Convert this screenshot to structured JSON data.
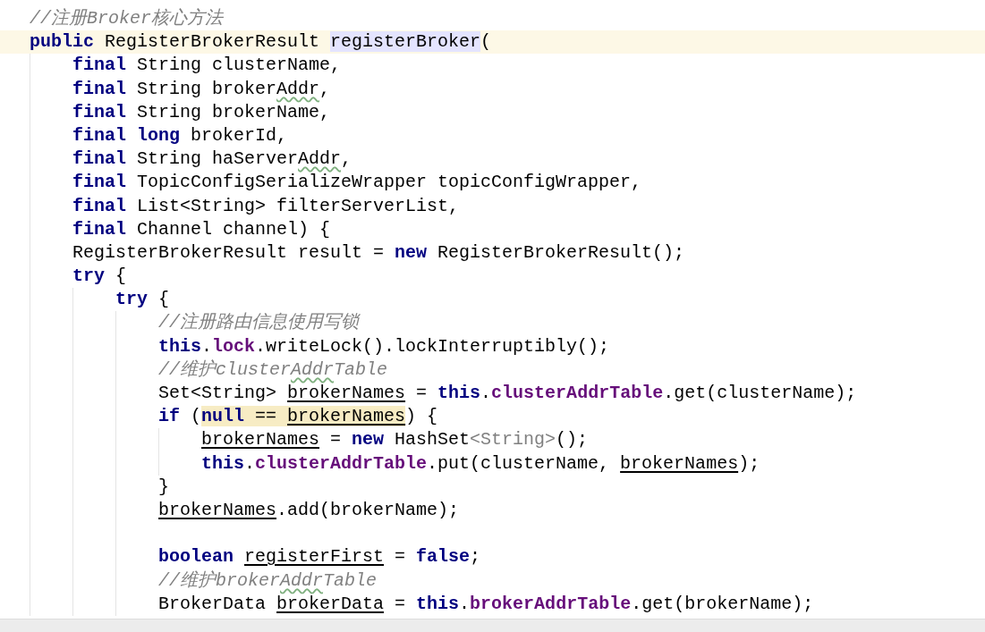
{
  "editor": {
    "lines": [
      {
        "kind": "code",
        "tokens": [
          {
            "text": "//注册Broker核心方法",
            "kind": "comment"
          }
        ]
      },
      {
        "kind": "code",
        "current": true,
        "tokens": [
          {
            "text": "public",
            "kind": "keyword"
          },
          {
            "text": " RegisterBrokerResult ",
            "kind": "plain"
          },
          {
            "text": "registerBroker",
            "kind": "plain",
            "usage": true
          },
          {
            "text": "(",
            "kind": "plain"
          }
        ],
        "children": [
          {
            "kind": "code",
            "tokens": [
              {
                "text": "final",
                "kind": "keyword"
              },
              {
                "text": " String clusterName,",
                "kind": "plain"
              }
            ]
          },
          {
            "kind": "code",
            "tokens": [
              {
                "text": "final",
                "kind": "keyword"
              },
              {
                "text": " String broker",
                "kind": "plain"
              },
              {
                "text": "Addr",
                "kind": "plain",
                "typo": true
              },
              {
                "text": ",",
                "kind": "plain"
              }
            ]
          },
          {
            "kind": "code",
            "tokens": [
              {
                "text": "final",
                "kind": "keyword"
              },
              {
                "text": " String brokerName,",
                "kind": "plain"
              }
            ]
          },
          {
            "kind": "code",
            "tokens": [
              {
                "text": "final ",
                "kind": "keyword"
              },
              {
                "text": "long",
                "kind": "keyword"
              },
              {
                "text": " brokerId,",
                "kind": "plain"
              }
            ]
          },
          {
            "kind": "code",
            "tokens": [
              {
                "text": "final",
                "kind": "keyword"
              },
              {
                "text": " String haServer",
                "kind": "plain"
              },
              {
                "text": "Addr",
                "kind": "plain",
                "typo": true
              },
              {
                "text": ",",
                "kind": "plain"
              }
            ]
          },
          {
            "kind": "code",
            "tokens": [
              {
                "text": "final",
                "kind": "keyword"
              },
              {
                "text": " TopicConfigSerializeWrapper topicConfigWrapper,",
                "kind": "plain"
              }
            ]
          },
          {
            "kind": "code",
            "tokens": [
              {
                "text": "final",
                "kind": "keyword"
              },
              {
                "text": " List<String> filterServerList,",
                "kind": "plain"
              }
            ]
          },
          {
            "kind": "code",
            "tokens": [
              {
                "text": "final",
                "kind": "keyword"
              },
              {
                "text": " Channel channel) {",
                "kind": "plain"
              }
            ]
          },
          {
            "kind": "code",
            "tokens": [
              {
                "text": "RegisterBrokerResult result = ",
                "kind": "plain"
              },
              {
                "text": "new",
                "kind": "keyword"
              },
              {
                "text": " RegisterBrokerResult();",
                "kind": "plain"
              }
            ]
          },
          {
            "kind": "code",
            "tokens": [
              {
                "text": "try",
                "kind": "keyword"
              },
              {
                "text": " {",
                "kind": "plain"
              }
            ],
            "children": [
              {
                "kind": "code",
                "tokens": [
                  {
                    "text": "try",
                    "kind": "keyword"
                  },
                  {
                    "text": " {",
                    "kind": "plain"
                  }
                ],
                "children": [
                  {
                    "kind": "code",
                    "tokens": [
                      {
                        "text": "//注册路由信息使用写锁",
                        "kind": "comment"
                      }
                    ]
                  },
                  {
                    "kind": "code",
                    "tokens": [
                      {
                        "text": "this",
                        "kind": "keyword"
                      },
                      {
                        "text": ".",
                        "kind": "plain"
                      },
                      {
                        "text": "lock",
                        "kind": "field"
                      },
                      {
                        "text": ".writeLock().lockInterruptibly();",
                        "kind": "plain"
                      }
                    ]
                  },
                  {
                    "kind": "code",
                    "tokens": [
                      {
                        "text": "//维护cluster",
                        "kind": "comment"
                      },
                      {
                        "text": "Addr",
                        "kind": "comment",
                        "typo": true
                      },
                      {
                        "text": "Table",
                        "kind": "comment"
                      }
                    ]
                  },
                  {
                    "kind": "code",
                    "tokens": [
                      {
                        "text": "Set<String> ",
                        "kind": "plain"
                      },
                      {
                        "text": "brokerNames",
                        "kind": "plain",
                        "underlined": true
                      },
                      {
                        "text": " = ",
                        "kind": "plain"
                      },
                      {
                        "text": "this",
                        "kind": "keyword"
                      },
                      {
                        "text": ".",
                        "kind": "plain"
                      },
                      {
                        "text": "clusterAddrTable",
                        "kind": "field"
                      },
                      {
                        "text": ".get(clusterName);",
                        "kind": "plain"
                      }
                    ]
                  },
                  {
                    "kind": "code",
                    "tokens": [
                      {
                        "text": "if",
                        "kind": "keyword"
                      },
                      {
                        "text": " (",
                        "kind": "plain"
                      },
                      {
                        "text": "null",
                        "kind": "keyword",
                        "match": true
                      },
                      {
                        "text": " == ",
                        "kind": "plain",
                        "match": true
                      },
                      {
                        "text": "brokerNames",
                        "kind": "plain",
                        "underlined": true,
                        "match": true
                      },
                      {
                        "text": ") {",
                        "kind": "plain"
                      }
                    ],
                    "children": [
                      {
                        "kind": "code",
                        "tokens": [
                          {
                            "text": "brokerNames",
                            "kind": "plain",
                            "underlined": true
                          },
                          {
                            "text": " = ",
                            "kind": "plain"
                          },
                          {
                            "text": "new",
                            "kind": "keyword"
                          },
                          {
                            "text": " HashSet",
                            "kind": "plain"
                          },
                          {
                            "text": "<String>",
                            "kind": "hint"
                          },
                          {
                            "text": "();",
                            "kind": "plain"
                          }
                        ]
                      },
                      {
                        "kind": "code",
                        "tokens": [
                          {
                            "text": "this",
                            "kind": "keyword"
                          },
                          {
                            "text": ".",
                            "kind": "plain"
                          },
                          {
                            "text": "clusterAddrTable",
                            "kind": "field"
                          },
                          {
                            "text": ".put(clusterName, ",
                            "kind": "plain"
                          },
                          {
                            "text": "brokerNames",
                            "kind": "plain",
                            "underlined": true
                          },
                          {
                            "text": ");",
                            "kind": "plain"
                          }
                        ]
                      }
                    ]
                  },
                  {
                    "kind": "code",
                    "tokens": [
                      {
                        "text": "}",
                        "kind": "plain"
                      }
                    ]
                  },
                  {
                    "kind": "code",
                    "tokens": [
                      {
                        "text": "brokerNames",
                        "kind": "plain",
                        "underlined": true
                      },
                      {
                        "text": ".add(brokerName);",
                        "kind": "plain"
                      }
                    ]
                  },
                  {
                    "kind": "blank"
                  },
                  {
                    "kind": "code",
                    "tokens": [
                      {
                        "text": "boolean ",
                        "kind": "keyword"
                      },
                      {
                        "text": "registerFirst",
                        "kind": "plain",
                        "underlined": true
                      },
                      {
                        "text": " = ",
                        "kind": "plain"
                      },
                      {
                        "text": "false",
                        "kind": "keyword"
                      },
                      {
                        "text": ";",
                        "kind": "plain"
                      }
                    ]
                  },
                  {
                    "kind": "code",
                    "tokens": [
                      {
                        "text": "//维护broker",
                        "kind": "comment"
                      },
                      {
                        "text": "Addr",
                        "kind": "comment",
                        "typo": true
                      },
                      {
                        "text": "Table",
                        "kind": "comment"
                      }
                    ]
                  },
                  {
                    "kind": "code",
                    "tokens": [
                      {
                        "text": "BrokerData ",
                        "kind": "plain"
                      },
                      {
                        "text": "brokerData",
                        "kind": "plain",
                        "underlined": true
                      },
                      {
                        "text": " = ",
                        "kind": "plain"
                      },
                      {
                        "text": "this",
                        "kind": "keyword"
                      },
                      {
                        "text": ".",
                        "kind": "plain"
                      },
                      {
                        "text": "brokerAddrTable",
                        "kind": "field"
                      },
                      {
                        "text": ".get(brokerName);",
                        "kind": "plain"
                      }
                    ]
                  }
                ]
              }
            ]
          }
        ]
      }
    ]
  }
}
